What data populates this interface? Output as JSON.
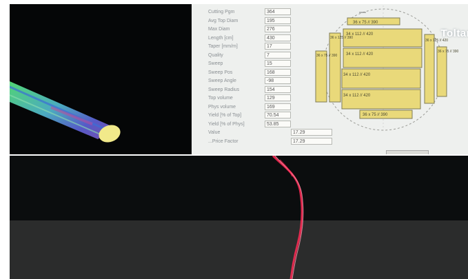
{
  "parameters": [
    {
      "label": "Cutting Pgm",
      "value": "364"
    },
    {
      "label": "Avg Top Diam",
      "value": "195"
    },
    {
      "label": "Max Diam",
      "value": "276"
    },
    {
      "label": "Length [cm]",
      "value": "430"
    },
    {
      "label": "Taper [mm/m]",
      "value": "17"
    },
    {
      "label": "Quality",
      "value": "7"
    },
    {
      "label": "Sweep",
      "value": "15"
    },
    {
      "label": "Sweep Pos",
      "value": "168"
    },
    {
      "label": "Sweep Angle",
      "value": "-98"
    },
    {
      "label": "Sweep Radius",
      "value": "154"
    },
    {
      "label": "Top volume",
      "value": "129"
    },
    {
      "label": "Phys volume",
      "value": "169"
    },
    {
      "label": "Yield [% of Top]",
      "value": "70.54"
    },
    {
      "label": "Yield [% of Phys]",
      "value": "53.85"
    },
    {
      "label": "Value",
      "value": "17.29"
    },
    {
      "label": "...Price Factor",
      "value": "17.29"
    }
  ],
  "cutting_pattern": {
    "top_board": "36 x 75 // 390",
    "center_boards": [
      "34 x 112 // 420",
      "34 x 112 // 420",
      "34 x 112 // 420",
      "34 x 112 // 420"
    ],
    "bottom_board": "36 x 75 // 390",
    "left_outer": "36 x 75 // 390",
    "left_inner": "36 x 125 // 390",
    "right_inner": "36 x 125 // 420",
    "right_outer": "36 x 75 // 390",
    "board_color": "#e9d97a",
    "outline_color": "#7d7a55"
  },
  "brand": "Toltar",
  "colors": {
    "viewport_bg": "#050607",
    "laser": "#ff2a55",
    "panel_bg": "#eef0ee"
  }
}
